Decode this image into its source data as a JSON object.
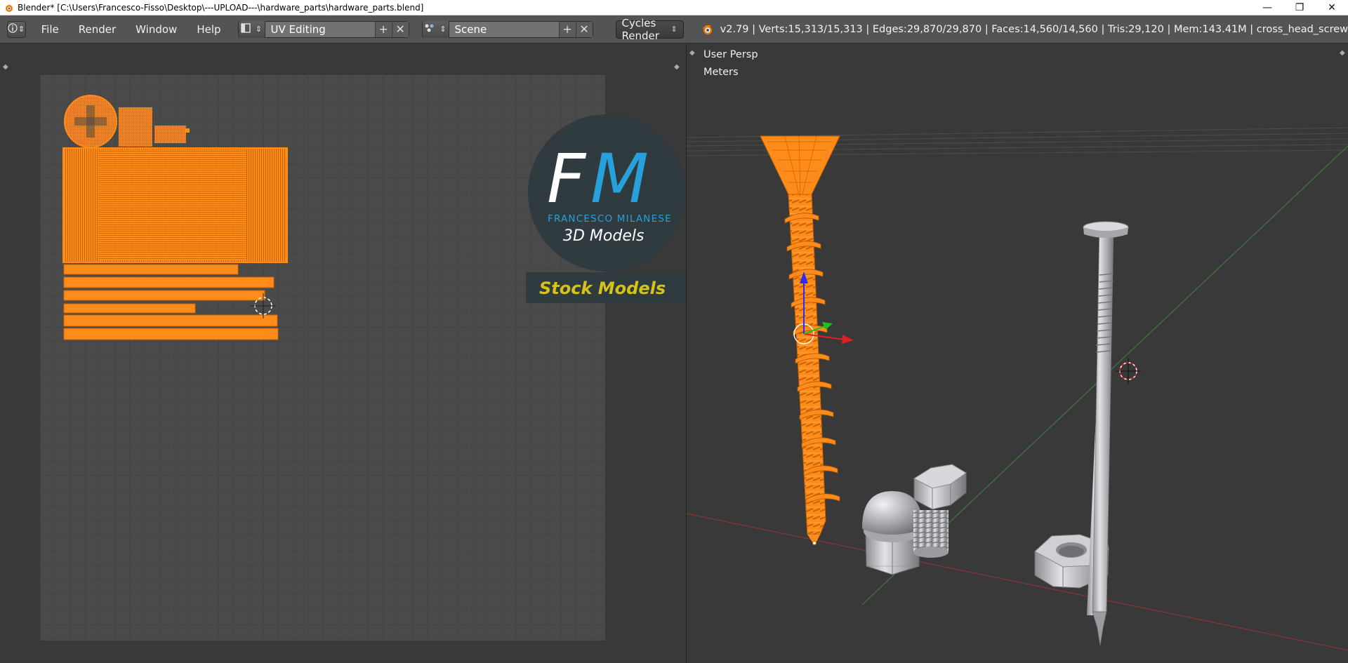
{
  "window": {
    "title": "Blender* [C:\\Users\\Francesco-Fisso\\Desktop\\---UPLOAD---\\hardware_parts\\hardware_parts.blend]",
    "controls": [
      "—",
      "❐",
      "✕"
    ]
  },
  "infobar": {
    "menus": [
      "File",
      "Render",
      "Window",
      "Help"
    ],
    "screen_layout": "UV Editing",
    "scene": "Scene",
    "render_engine": "Cycles Render",
    "stats": "v2.79 | Verts:15,313/15,313 | Edges:29,870/29,870 | Faces:14,560/14,560 | Tris:29,120 | Mem:143.41M | cross_head_screw"
  },
  "viewport": {
    "view_name": "User Persp",
    "units": "Meters"
  },
  "watermark": {
    "initials_f": "F",
    "initials_m": "M",
    "author": "FRANCESCO MILANESE",
    "subtitle": "3D Models",
    "banner": "Stock Models"
  },
  "colors": {
    "selection_orange": "#ff8c1a",
    "wire_orange": "#c86400",
    "background": "#393939",
    "grid_fill": "#4a4a4a",
    "header": "#545454",
    "watermark_blue": "#27a0dc",
    "banner_yellow": "#d4c41a"
  },
  "icons": [
    "info-icon",
    "layout-icon",
    "scene-icon",
    "blender-logo-icon",
    "plus-icon",
    "close-icon",
    "dropdown-arrows-icon",
    "cursor-crosshair-icon"
  ]
}
